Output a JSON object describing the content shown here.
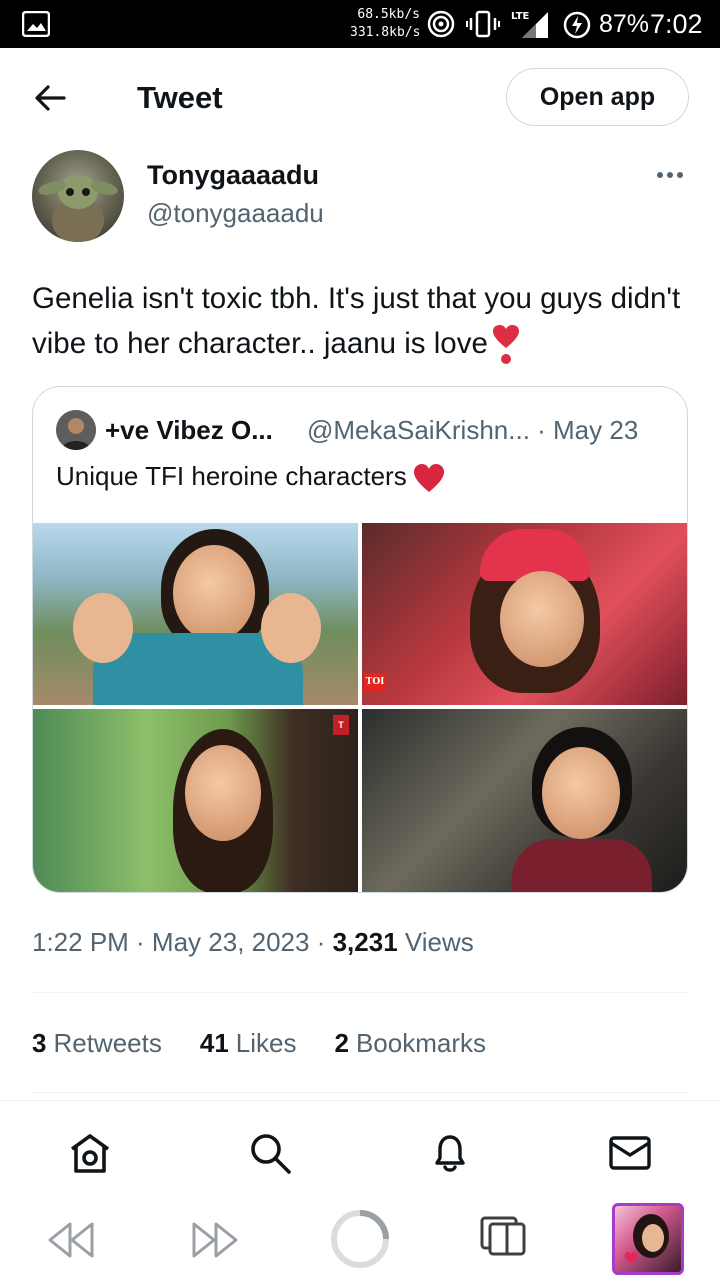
{
  "status_bar": {
    "speed_up": "68.5kb/s",
    "speed_down": "331.8kb/s",
    "network": "LTE",
    "battery": "87%",
    "time": "7:02"
  },
  "header": {
    "title": "Tweet",
    "open_app_label": "Open app",
    "back_icon": "arrow-left-icon"
  },
  "tweet": {
    "author_name": "Tonygaaaadu",
    "author_handle": "@tonygaaaadu",
    "text": "Genelia isn't toxic tbh. It's just that you guys didn't vibe to her character.. jaanu is love",
    "timestamp": "1:22 PM · May 23, 2023 · ",
    "views_count": "3,231",
    "views_label": " Views",
    "retweets_count": "3",
    "retweets_label": "Retweets",
    "likes_count": "41",
    "likes_label": "Likes",
    "bookmarks_count": "2",
    "bookmarks_label": "Bookmarks"
  },
  "quoted_tweet": {
    "author_name": "+ve Vibez O...",
    "author_meta": "@MekaSaiKrishn... · May 23",
    "text": "Unique TFI heroine characters",
    "tile_badge_1": "TOI",
    "tile_badge_2": "T"
  },
  "bottom_nav": [
    "home-icon",
    "search-icon",
    "notifications-icon",
    "messages-icon"
  ],
  "colors": {
    "text_primary": "#0f1419",
    "text_secondary": "#536471",
    "border": "#cfd9de",
    "heart_red": "#d7263d"
  }
}
